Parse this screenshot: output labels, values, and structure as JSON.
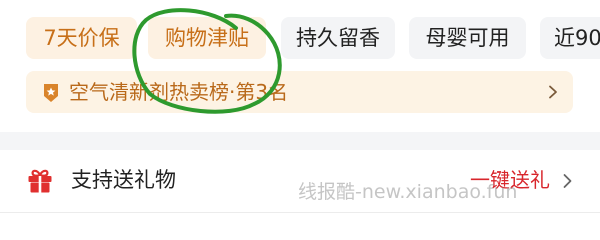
{
  "tags": [
    {
      "label": "7天价保",
      "style": "accent"
    },
    {
      "label": "购物津贴",
      "style": "accent"
    },
    {
      "label": "持久留香",
      "style": "plain"
    },
    {
      "label": "母婴可用",
      "style": "plain"
    },
    {
      "label": "近90",
      "style": "plain"
    }
  ],
  "ranking": {
    "text": "空气清新剂热卖榜·第3名",
    "icon": "medal-badge-icon"
  },
  "gift": {
    "label": "支持送礼物",
    "action": "一键送礼",
    "icon": "gift-box-icon"
  },
  "watermark": "线报酷-new.xianbao.fun",
  "colors": {
    "accent_text": "#c76f18",
    "accent_bg": "#fdf1e2",
    "plain_bg": "#f3f4f6",
    "red": "#d8262c",
    "annotation_green": "#2e9a2e"
  }
}
